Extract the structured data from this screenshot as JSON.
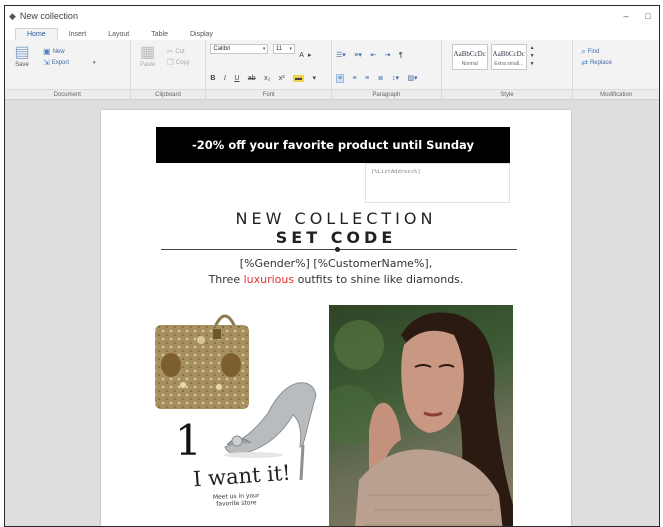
{
  "window": {
    "title": "New collection",
    "minimize_glyph": "–",
    "maximize_glyph": "□"
  },
  "tabs": [
    {
      "label": "Home",
      "active": true
    },
    {
      "label": "Insert",
      "active": false
    },
    {
      "label": "Layout",
      "active": false
    },
    {
      "label": "Table",
      "active": false
    },
    {
      "label": "Display",
      "active": false
    }
  ],
  "ribbon": {
    "document": {
      "label": "Document",
      "save": "Save",
      "new": "New",
      "export": "Export"
    },
    "clipboard": {
      "label": "Clipboard",
      "paste": "Paste",
      "cut": "Cut",
      "copy": "Copy"
    },
    "font": {
      "label": "Font",
      "family": "Calibri",
      "size": "11"
    },
    "paragraph": {
      "label": "Paragraph"
    },
    "style": {
      "label": "Style",
      "styles": [
        {
          "sample": "AaBbCcDc",
          "name": "Normal"
        },
        {
          "sample": "AaBbCcDc",
          "name": "Extra small..."
        }
      ]
    },
    "modification": {
      "label": "Modification",
      "find": "Find",
      "replace": "Replace"
    }
  },
  "document": {
    "promo": "-20% off your favorite product until Sunday",
    "placeholder": "[%ListAddress%]",
    "headline": "NEW COLLECTION",
    "subheadline": "SET CODE",
    "greeting": "[%Gender%] [%CustomerName%],",
    "tagline_before": "Three ",
    "tagline_highlight": "luxurious",
    "tagline_after": " outfits to shine like diamonds.",
    "number": "1",
    "handwriting": "I want it!",
    "note_line1": "Meet us in your",
    "note_line2": "favorite store"
  },
  "colors": {
    "promo_bg": "#000000",
    "highlight_red": "#e53030",
    "accent_blue": "#3c6aa8"
  }
}
